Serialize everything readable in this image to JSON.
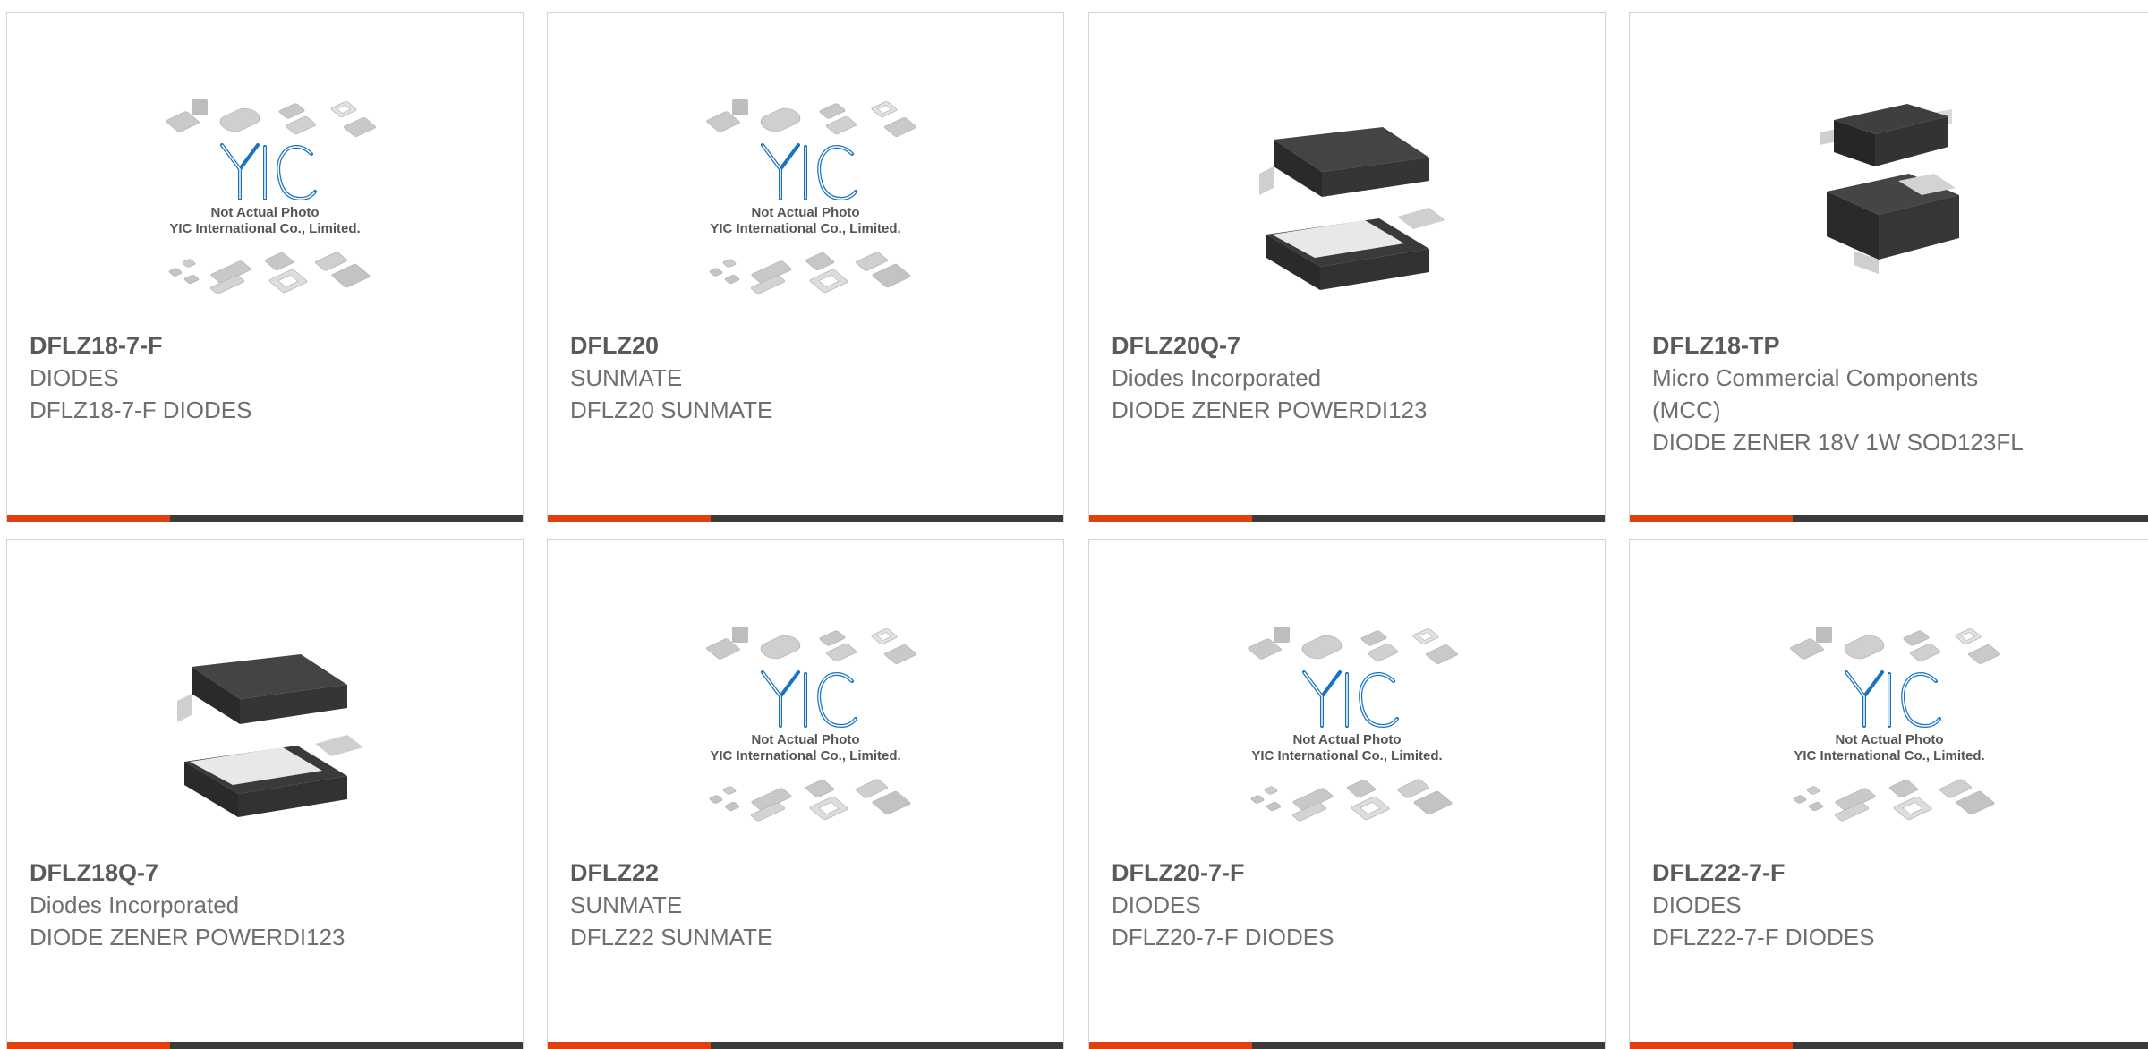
{
  "colors": {
    "accent": "#e0400f",
    "bar_dark": "#3b3b3b",
    "yic_blue": "#1a73c2"
  },
  "products": [
    {
      "part": "DFLZ18-7-F",
      "maker": "DIODES",
      "desc": "DFLZ18-7-F DIODES",
      "image": "placeholder",
      "placeholder_line1": "Not Actual Photo",
      "placeholder_line2": "YIC International Co., Limited.",
      "logo": "YIC"
    },
    {
      "part": "DFLZ20",
      "maker": "SUNMATE",
      "desc": "DFLZ20 SUNMATE",
      "image": "placeholder",
      "placeholder_line1": "Not Actual Photo",
      "placeholder_line2": "YIC International Co., Limited.",
      "logo": "YIC"
    },
    {
      "part": "DFLZ20Q-7",
      "maker": "Diodes Incorporated",
      "desc": "DIODE ZENER POWERDI123",
      "image": "powerdi123"
    },
    {
      "part": "DFLZ18-TP",
      "maker": "Micro Commercial Components (MCC)",
      "desc": "DIODE ZENER 18V 1W SOD123FL",
      "image": "sod123fl"
    },
    {
      "part": "DFLZ18Q-7",
      "maker": "Diodes Incorporated",
      "desc": "DIODE ZENER POWERDI123",
      "image": "powerdi123"
    },
    {
      "part": "DFLZ22",
      "maker": "SUNMATE",
      "desc": "DFLZ22 SUNMATE",
      "image": "placeholder",
      "placeholder_line1": "Not Actual Photo",
      "placeholder_line2": "YIC International Co., Limited.",
      "logo": "YIC"
    },
    {
      "part": "DFLZ20-7-F",
      "maker": "DIODES",
      "desc": "DFLZ20-7-F DIODES",
      "image": "placeholder",
      "placeholder_line1": "Not Actual Photo",
      "placeholder_line2": "YIC International Co., Limited.",
      "logo": "YIC"
    },
    {
      "part": "DFLZ22-7-F",
      "maker": "DIODES",
      "desc": "DFLZ22-7-F DIODES",
      "image": "placeholder",
      "placeholder_line1": "Not Actual Photo",
      "placeholder_line2": "YIC International Co., Limited.",
      "logo": "YIC"
    }
  ]
}
